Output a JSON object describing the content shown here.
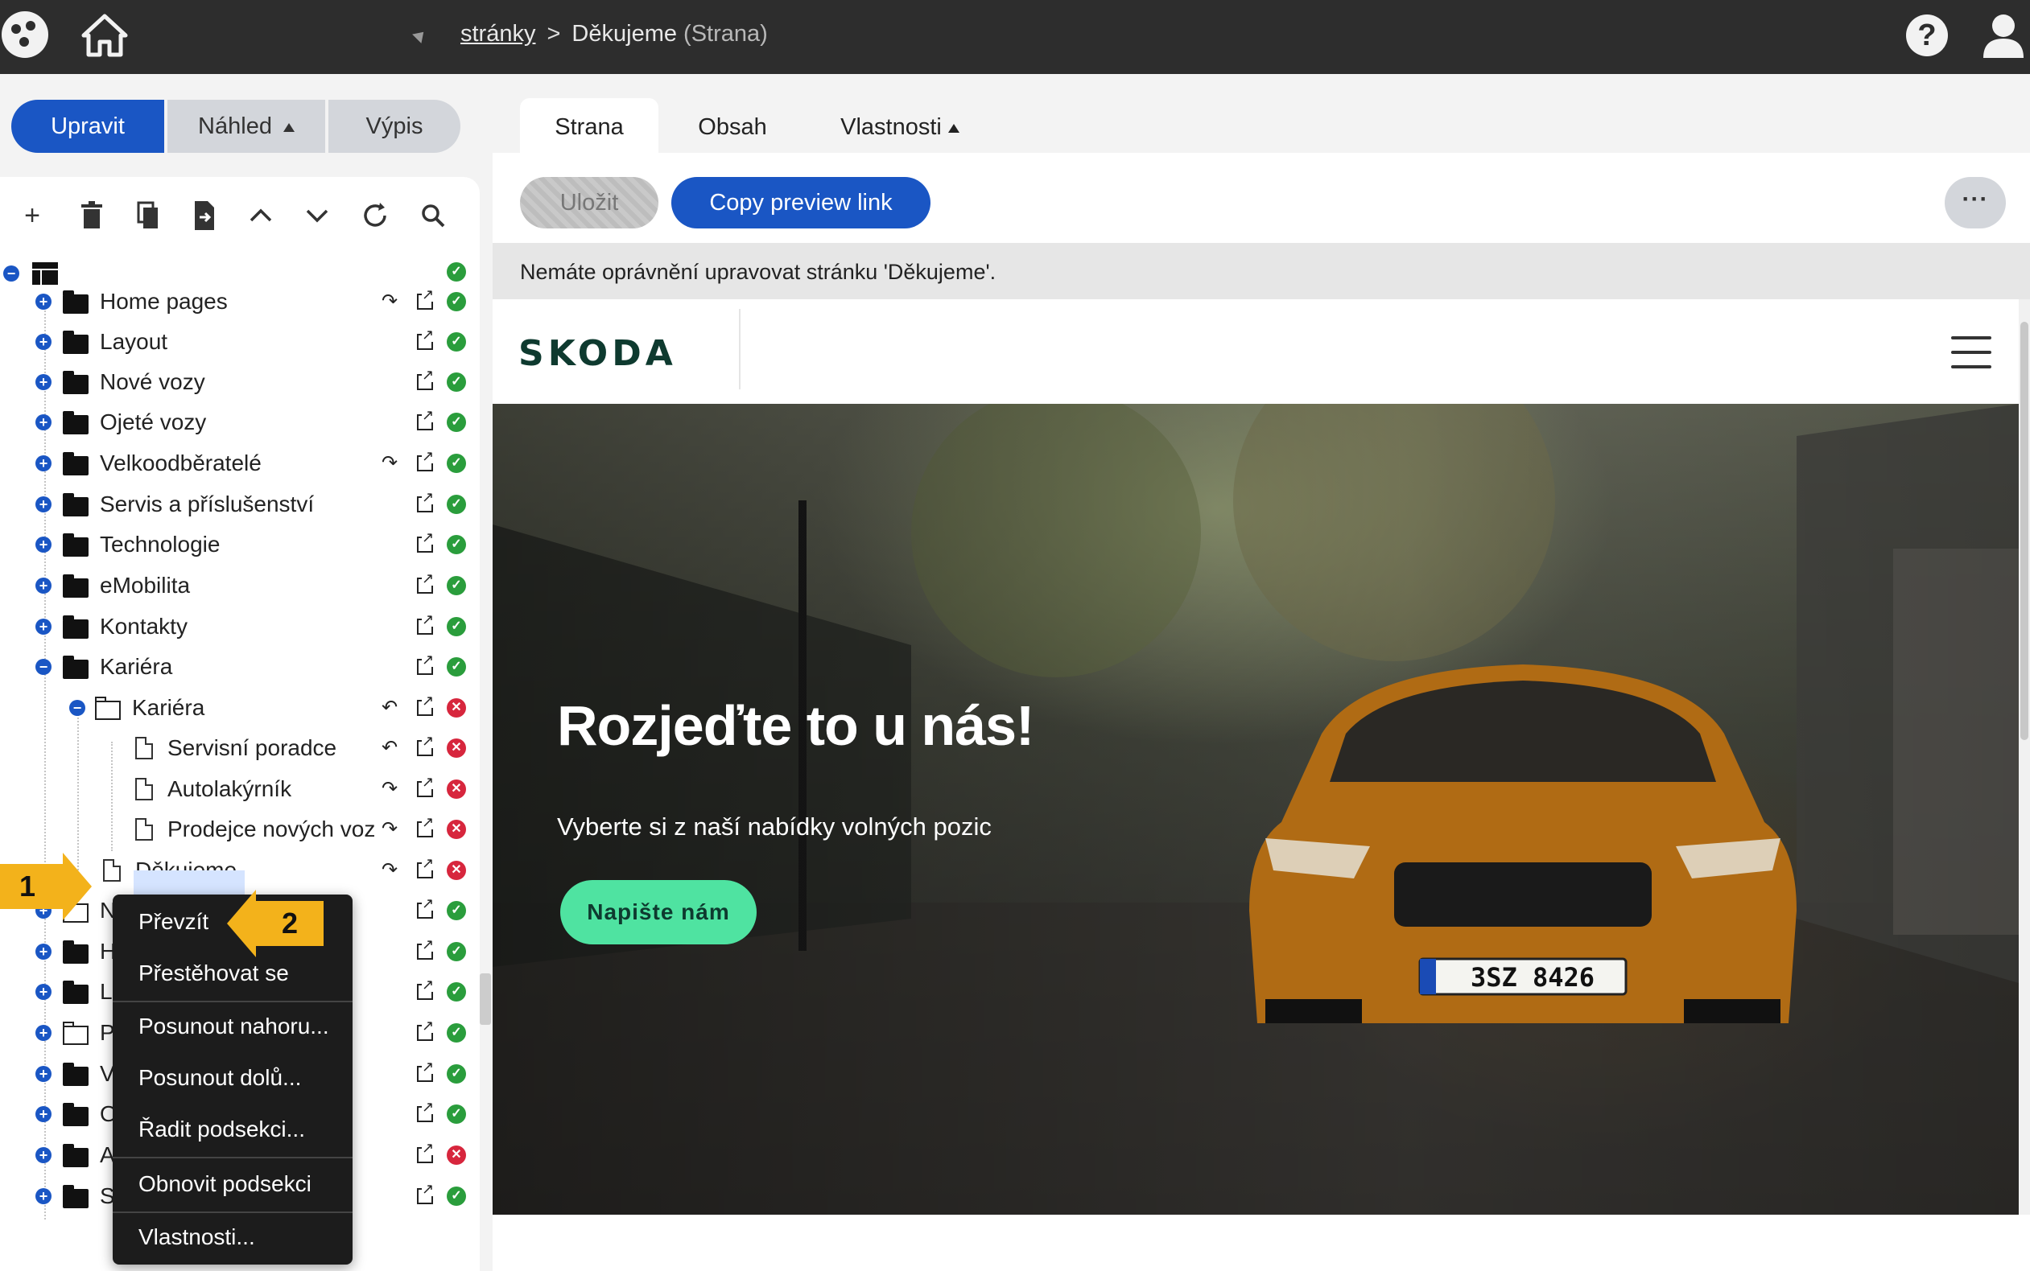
{
  "topbar": {
    "breadcrumb_link": "stránky",
    "breadcrumb_sep": ">",
    "breadcrumb_current": "Děkujeme",
    "breadcrumb_type": "(Strana)"
  },
  "modes": {
    "edit": "Upravit",
    "preview": "Náhled",
    "list": "Výpis"
  },
  "tree": {
    "items": [
      {
        "label": "Home pages",
        "status": "ok",
        "cycle": "↷"
      },
      {
        "label": "Layout",
        "status": "ok",
        "cycle": ""
      },
      {
        "label": "Nové vozy",
        "status": "ok",
        "cycle": ""
      },
      {
        "label": "Ojeté vozy",
        "status": "ok",
        "cycle": ""
      },
      {
        "label": "Velkoodběratelé",
        "status": "ok",
        "cycle": "↷"
      },
      {
        "label": "Servis a příslušenství",
        "status": "ok",
        "cycle": ""
      },
      {
        "label": "Technologie",
        "status": "ok",
        "cycle": ""
      },
      {
        "label": "eMobilita",
        "status": "ok",
        "cycle": ""
      },
      {
        "label": "Kontakty",
        "status": "ok",
        "cycle": ""
      },
      {
        "label": "Kariéra",
        "status": "ok",
        "cycle": ""
      },
      {
        "label": "Kariéra",
        "status": "error",
        "cycle": "↶"
      },
      {
        "label": "Servisní poradce",
        "status": "error",
        "cycle": "↶"
      },
      {
        "label": "Autolakýrník",
        "status": "error",
        "cycle": "↷"
      },
      {
        "label": "Prodejce nových voz",
        "status": "error",
        "cycle": "↷"
      },
      {
        "label": "Děkujeme",
        "status": "error",
        "cycle": "↷"
      },
      {
        "label": "N",
        "status": "ok",
        "cycle": ""
      },
      {
        "label": "H",
        "status": "ok",
        "cycle": ""
      },
      {
        "label": "L",
        "status": "ok",
        "cycle": ""
      },
      {
        "label": "P",
        "status": "ok",
        "cycle": ""
      },
      {
        "label": "V",
        "status": "ok",
        "cycle": ""
      },
      {
        "label": "O",
        "status": "ok",
        "cycle": ""
      },
      {
        "label": "A",
        "status": "error",
        "cycle": ""
      },
      {
        "label": "S",
        "status": "ok",
        "cycle": ""
      }
    ]
  },
  "context_menu": {
    "items": [
      "Převzít",
      "Přestěhovat se",
      "Posunout nahoru...",
      "Posunout dolů...",
      "Řadit podsekci...",
      "Obnovit podsekci",
      "Vlastnosti..."
    ]
  },
  "callouts": {
    "one": "1",
    "two": "2"
  },
  "tabs": {
    "page": "Strana",
    "content": "Obsah",
    "properties": "Vlastnosti"
  },
  "actions": {
    "save": "Uložit",
    "copy_preview": "Copy preview link",
    "more": "···"
  },
  "notice": "Nemáte oprávnění upravovat stránku 'Děkujeme'.",
  "preview": {
    "brand": "SKODA",
    "hero_title": "Rozjeďte to u nás!",
    "hero_subtitle": "Vyberte si z naší nabídky volných pozic",
    "cta": "Napište nám",
    "plate": "3SZ 8426"
  },
  "colors": {
    "accent": "#1a56c4",
    "ok": "#2a9d3c",
    "error": "#d7263d",
    "callout": "#f3b21b",
    "cta": "#4fe3a1"
  }
}
